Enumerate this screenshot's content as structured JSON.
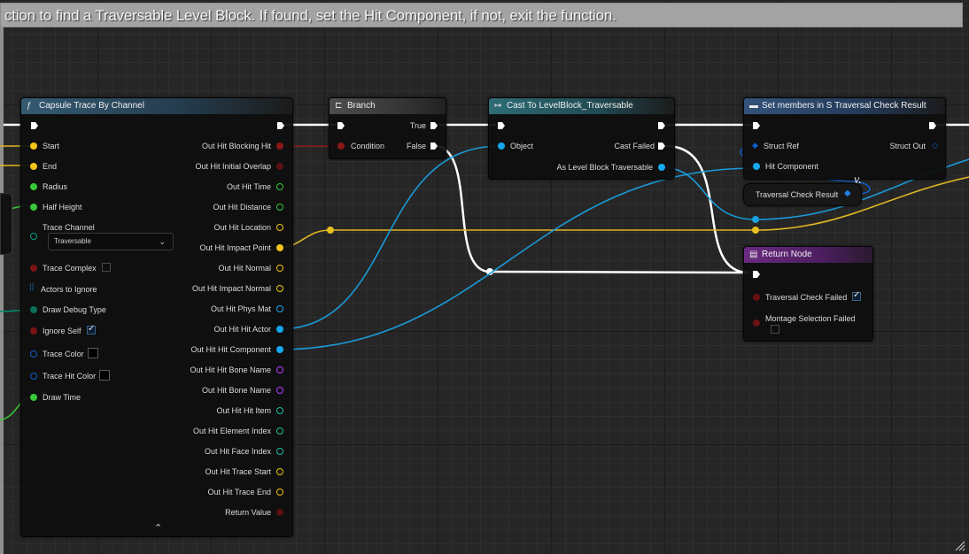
{
  "comment": {
    "text": "ction to find a Traversable Level Block. If found, set the Hit Component, if not, exit the function."
  },
  "pin_colors": {
    "exec": "#ffffff",
    "vector": "#f5c518",
    "float": "#38c738",
    "struct": "#1060c8",
    "object": "#14a8f0",
    "bool": "#8a1818",
    "name": "#b040ff",
    "byte": "#00a080",
    "string": "#e040e0",
    "array": "#2080c0"
  },
  "nodes": {
    "capsule": {
      "title": "Capsule Trace By Channel",
      "icon": "function-icon",
      "inputs": {
        "start": "Start",
        "end": "End",
        "radius": "Radius",
        "half_height": "Half Height",
        "trace_channel": "Trace Channel",
        "trace_channel_value": "Traversable",
        "trace_complex": "Trace Complex",
        "actors_to_ignore": "Actors to Ignore",
        "draw_debug_type": "Draw Debug Type",
        "ignore_self": "Ignore Self",
        "trace_color": "Trace Color",
        "trace_hit_color": "Trace Hit Color",
        "draw_time": "Draw Time"
      },
      "outputs": {
        "blocking_hit": "Out Hit Blocking Hit",
        "initial_overlap": "Out Hit Initial Overlap",
        "time": "Out Hit Time",
        "distance": "Out Hit Distance",
        "location": "Out Hit Location",
        "impact_point": "Out Hit Impact Point",
        "normal": "Out Hit Normal",
        "impact_normal": "Out Hit Impact Normal",
        "phys_mat": "Out Hit Phys Mat",
        "hit_actor": "Out Hit Hit Actor",
        "hit_component": "Out Hit Hit Component",
        "hit_bone_name": "Out Hit Hit Bone Name",
        "bone_name": "Out Hit Bone Name",
        "hit_item": "Out Hit Hit Item",
        "element_index": "Out Hit Element Index",
        "face_index": "Out Hit Face Index",
        "trace_start": "Out Hit Trace Start",
        "trace_end": "Out Hit Trace End",
        "return_value": "Return Value"
      }
    },
    "branch": {
      "title": "Branch",
      "icon": "branch-icon",
      "condition": "Condition",
      "true_label": "True",
      "false_label": "False"
    },
    "cast": {
      "title": "Cast To LevelBlock_Traversable",
      "icon": "cast-icon",
      "object": "Object",
      "cast_failed": "Cast Failed",
      "as_level_block": "As Level Block Traversable"
    },
    "set_members": {
      "title": "Set members in S Traversal Check Result",
      "icon": "struct-icon",
      "struct_ref": "Struct Ref",
      "struct_out": "Struct Out",
      "hit_component": "Hit Component"
    },
    "traversal_var": {
      "label": "Traversal Check Result"
    },
    "return_node": {
      "title": "Return Node",
      "icon": "function-icon",
      "traversal_failed": "Traversal Check Failed",
      "montage_failed": "Montage Selection Failed"
    }
  }
}
